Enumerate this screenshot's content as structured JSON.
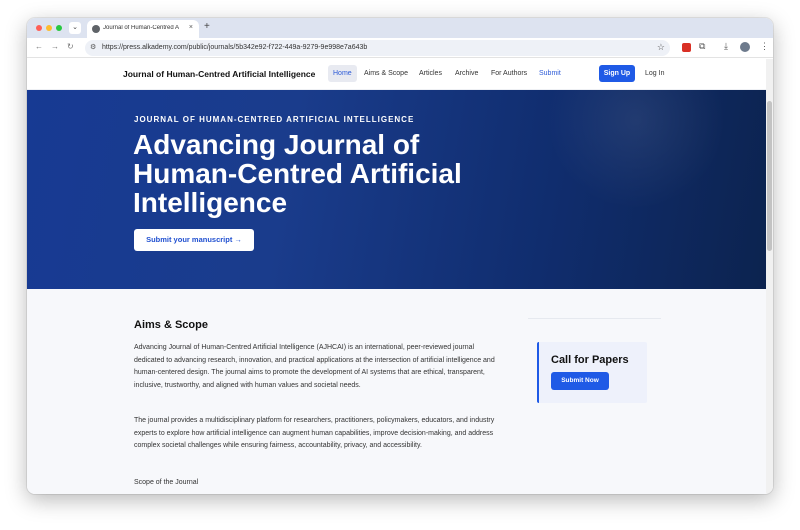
{
  "browser": {
    "tab_title": "Journal of Human-Centred A",
    "tab_close": "×",
    "new_tab": "+",
    "url": "https://press.alkademy.com/public/journals/5b342e92-f722-449a-9279-9e998e7a643b",
    "icons": [
      "back-icon",
      "forward-icon",
      "reload-icon",
      "star-icon",
      "extension-icon",
      "puzzle-icon",
      "download-icon",
      "profile-avatar",
      "menu-icon"
    ]
  },
  "header": {
    "brand": "Journal of Human-Centred Artificial Intelligence",
    "nav": [
      {
        "label": "Home",
        "active": true
      },
      {
        "label": "Aims & Scope"
      },
      {
        "label": "Articles"
      },
      {
        "label": "Archive"
      },
      {
        "label": "For Authors"
      },
      {
        "label": "Submit"
      }
    ],
    "signup": "Sign Up",
    "login": "Log In"
  },
  "hero": {
    "kicker": "JOURNAL OF HUMAN-CENTRED ARTIFICIAL INTELLIGENCE",
    "title": "Advancing Journal of Human-Centred Artificial Intelligence",
    "cta": "Submit your manuscript →"
  },
  "aims": {
    "title": "Aims & Scope",
    "paragraph1": "Advancing Journal of Human-Centred Artificial Intelligence (AJHCAI) is an international, peer-reviewed journal dedicated to advancing research, innovation, and practical applications at the intersection of artificial intelligence and human-centered design. The journal aims to promote the development of AI systems that are ethical, transparent, inclusive, trustworthy, and aligned with human values and societal needs.",
    "paragraph2": "The journal provides a multidisciplinary platform for researchers, practitioners, policymakers, educators, and industry experts to explore how artificial intelligence can augment human capabilities, improve decision-making, and address complex societal challenges while ensuring fairness, accountability, privacy, and accessibility.",
    "scope_heading": "Scope of the Journal"
  },
  "sidebar": {
    "cfp_title": "Call for Papers",
    "cfp_button": "Submit Now"
  },
  "colors": {
    "accent": "#1f5ae6",
    "hero_start": "#173a93",
    "hero_end": "#0c234f"
  }
}
